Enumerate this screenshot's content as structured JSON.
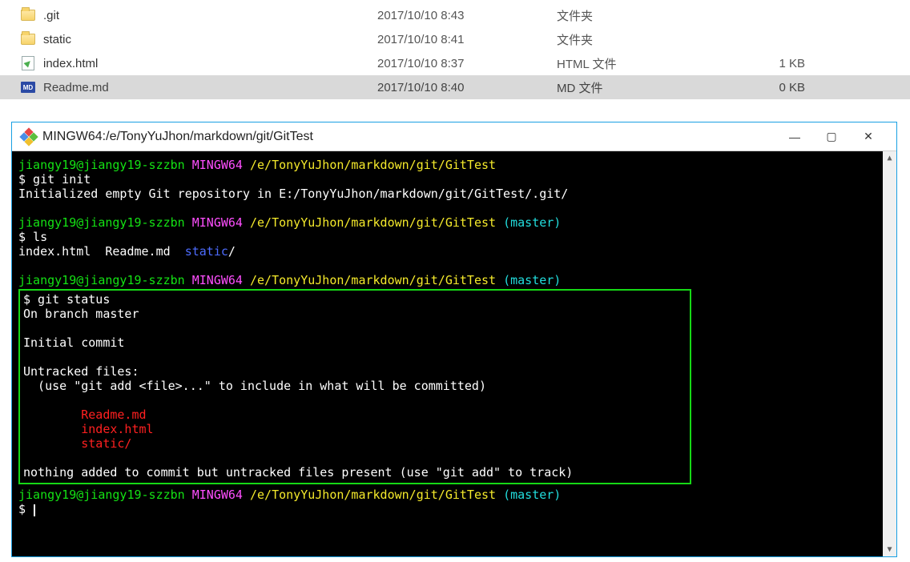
{
  "files": [
    {
      "name": ".git",
      "date": "2017/10/10 8:43",
      "type": "文件夹",
      "size": ""
    },
    {
      "name": "static",
      "date": "2017/10/10 8:41",
      "type": "文件夹",
      "size": ""
    },
    {
      "name": "index.html",
      "date": "2017/10/10 8:37",
      "type": "HTML 文件",
      "size": "1 KB"
    },
    {
      "name": "Readme.md",
      "date": "2017/10/10 8:40",
      "type": "MD 文件",
      "size": "0 KB"
    }
  ],
  "md_icon_label": "MD",
  "terminal": {
    "title": "MINGW64:/e/TonyYuJhon/markdown/git/GitTest",
    "prompt": {
      "user": "jiangy19@jiangy19-szzbn",
      "env": "MINGW64",
      "path": "/e/TonyYuJhon/markdown/git/GitTest",
      "branch": "(master)"
    },
    "cmds": {
      "init": "$ git init",
      "init_out": "Initialized empty Git repository in E:/TonyYuJhon/markdown/git/GitTest/.git/",
      "ls": "$ ls",
      "ls_out_white1": "index.html  Readme.md  ",
      "ls_out_blue": "static",
      "ls_out_white2": "/",
      "status_cmd": "$ git status",
      "status_branch": "On branch master",
      "status_initial": "Initial commit",
      "untracked_hdr": "Untracked files:",
      "untracked_hint": "  (use \"git add <file>...\" to include in what will be committed)",
      "u1": "        Readme.md",
      "u2": "        index.html",
      "u3": "        static/",
      "nothing": "nothing added to commit but untracked files present (use \"git add\" to track)",
      "final_prompt": "$ "
    },
    "win_min": "—",
    "win_max": "▢",
    "win_close": "✕",
    "scroll_up": "▲",
    "scroll_down": "▼"
  }
}
